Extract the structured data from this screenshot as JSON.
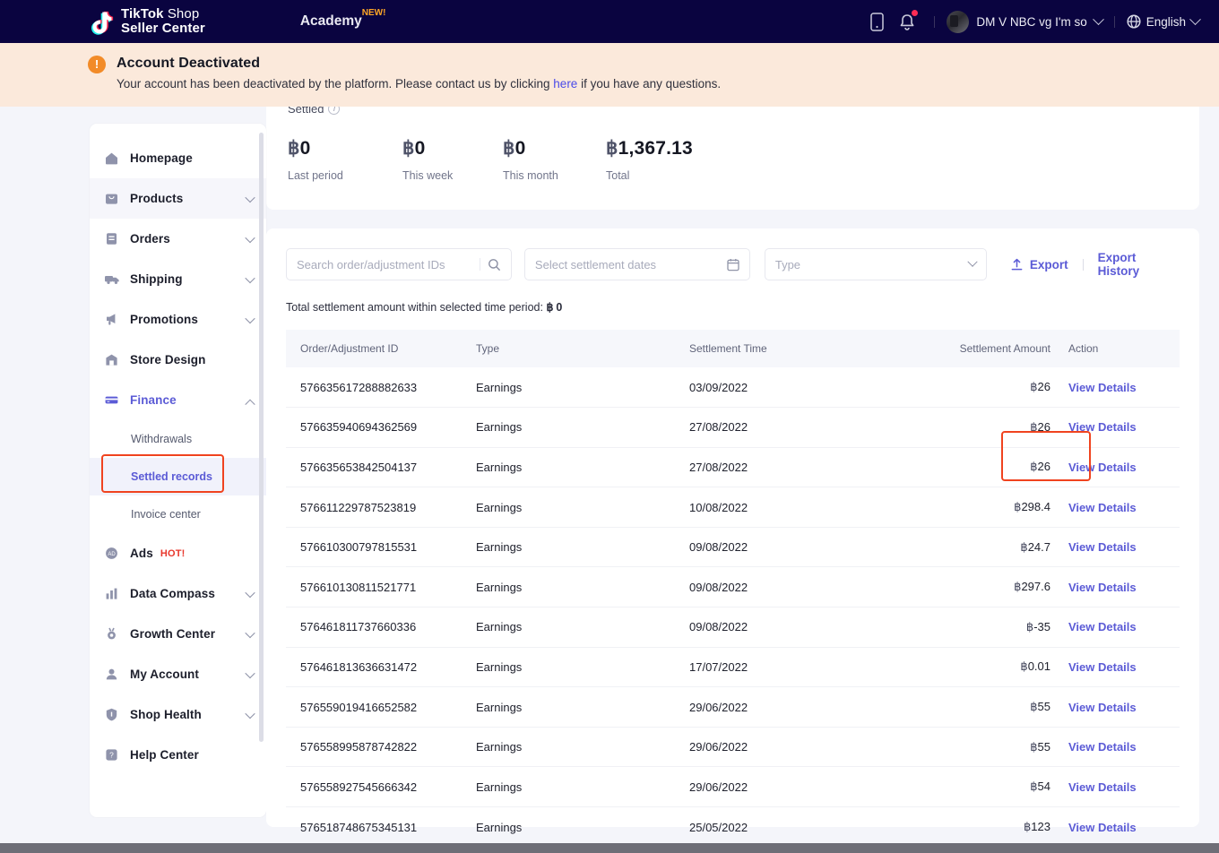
{
  "header": {
    "logo_line1_bold": "TikTok",
    "logo_line1_thin": " Shop",
    "logo_line2": "Seller Center",
    "academy": "Academy",
    "academy_badge": "NEW!",
    "user_name": "DM V NBC vg I'm so",
    "language": "English",
    "icons": {
      "mobile": "mobile-icon",
      "bell": "bell-icon",
      "globe": "globe-icon"
    },
    "bg_color": "#0a0440"
  },
  "alert": {
    "title": "Account Deactivated",
    "text_before": "Your account has been deactivated by the platform. Please contact us by clicking ",
    "link": "here",
    "text_after": " if you have any questions.",
    "bg_color": "#fbe9db",
    "icon_color": "#f28b28"
  },
  "sidebar": {
    "items": [
      {
        "label": "Homepage",
        "icon": "home-icon",
        "expandable": false
      },
      {
        "label": "Products",
        "icon": "bag-icon",
        "expandable": true
      },
      {
        "label": "Orders",
        "icon": "orders-icon",
        "expandable": true
      },
      {
        "label": "Shipping",
        "icon": "truck-icon",
        "expandable": true
      },
      {
        "label": "Promotions",
        "icon": "megaphone-icon",
        "expandable": true
      },
      {
        "label": "Store Design",
        "icon": "store-icon",
        "expandable": false
      },
      {
        "label": "Finance",
        "icon": "card-icon",
        "expandable": true
      },
      {
        "label": "Ads",
        "icon": "ads-icon",
        "badge": "HOT!",
        "expandable": false
      },
      {
        "label": "Data Compass",
        "icon": "bar-chart-icon",
        "expandable": true
      },
      {
        "label": "Growth Center",
        "icon": "medal-icon",
        "expandable": true
      },
      {
        "label": "My Account",
        "icon": "user-icon",
        "expandable": true
      },
      {
        "label": "Shop Health",
        "icon": "shield-icon",
        "expandable": true
      },
      {
        "label": "Help Center",
        "icon": "help-icon",
        "expandable": false
      }
    ],
    "finance_subitems": [
      {
        "label": "Withdrawals",
        "active": false
      },
      {
        "label": "Settled records",
        "active": true
      },
      {
        "label": "Invoice center",
        "active": false
      }
    ],
    "active_color": "#5b5bd6",
    "highlight_color": "#f0431f"
  },
  "summary": {
    "title": "Settled",
    "stats": [
      {
        "value": "฿0",
        "currency": "฿",
        "amount": "0",
        "label": "Last period"
      },
      {
        "value": "฿0",
        "currency": "฿",
        "amount": "0",
        "label": "This week"
      },
      {
        "value": "฿0",
        "currency": "฿",
        "amount": "0",
        "label": "This month"
      },
      {
        "value": "฿1,367.13",
        "currency": "฿",
        "amount": "1,367.13",
        "label": "Total"
      }
    ]
  },
  "filters": {
    "search_placeholder": "Search order/adjustment IDs",
    "date_placeholder": "Select settlement dates",
    "type_placeholder": "Type",
    "export_label": "Export",
    "export_history_label": "Export History"
  },
  "table": {
    "total_label": "Total settlement amount within selected time period: ",
    "total_currency": "฿",
    "total_value": "0",
    "columns": [
      "Order/Adjustment ID",
      "Type",
      "Settlement Time",
      "Settlement Amount",
      "Action"
    ],
    "action_label": "View Details",
    "rows": [
      {
        "id": "576635617288882633",
        "type": "Earnings",
        "time": "03/09/2022",
        "currency": "฿",
        "amount": "26"
      },
      {
        "id": "576635940694362569",
        "type": "Earnings",
        "time": "27/08/2022",
        "currency": "฿",
        "amount": "26"
      },
      {
        "id": "576635653842504137",
        "type": "Earnings",
        "time": "27/08/2022",
        "currency": "฿",
        "amount": "26"
      },
      {
        "id": "576611229787523819",
        "type": "Earnings",
        "time": "10/08/2022",
        "currency": "฿",
        "amount": "298.4"
      },
      {
        "id": "576610300797815531",
        "type": "Earnings",
        "time": "09/08/2022",
        "currency": "฿",
        "amount": "24.7"
      },
      {
        "id": "576610130811521771",
        "type": "Earnings",
        "time": "09/08/2022",
        "currency": "฿",
        "amount": "297.6"
      },
      {
        "id": "576461811737660336",
        "type": "Earnings",
        "time": "09/08/2022",
        "currency": "฿",
        "amount": "-35"
      },
      {
        "id": "576461813636631472",
        "type": "Earnings",
        "time": "17/07/2022",
        "currency": "฿",
        "amount": "0.01"
      },
      {
        "id": "576559019416652582",
        "type": "Earnings",
        "time": "29/06/2022",
        "currency": "฿",
        "amount": "55"
      },
      {
        "id": "576558995878742822",
        "type": "Earnings",
        "time": "29/06/2022",
        "currency": "฿",
        "amount": "55"
      },
      {
        "id": "576558927545666342",
        "type": "Earnings",
        "time": "29/06/2022",
        "currency": "฿",
        "amount": "54"
      },
      {
        "id": "576518748675345131",
        "type": "Earnings",
        "time": "25/05/2022",
        "currency": "฿",
        "amount": "123"
      }
    ]
  }
}
